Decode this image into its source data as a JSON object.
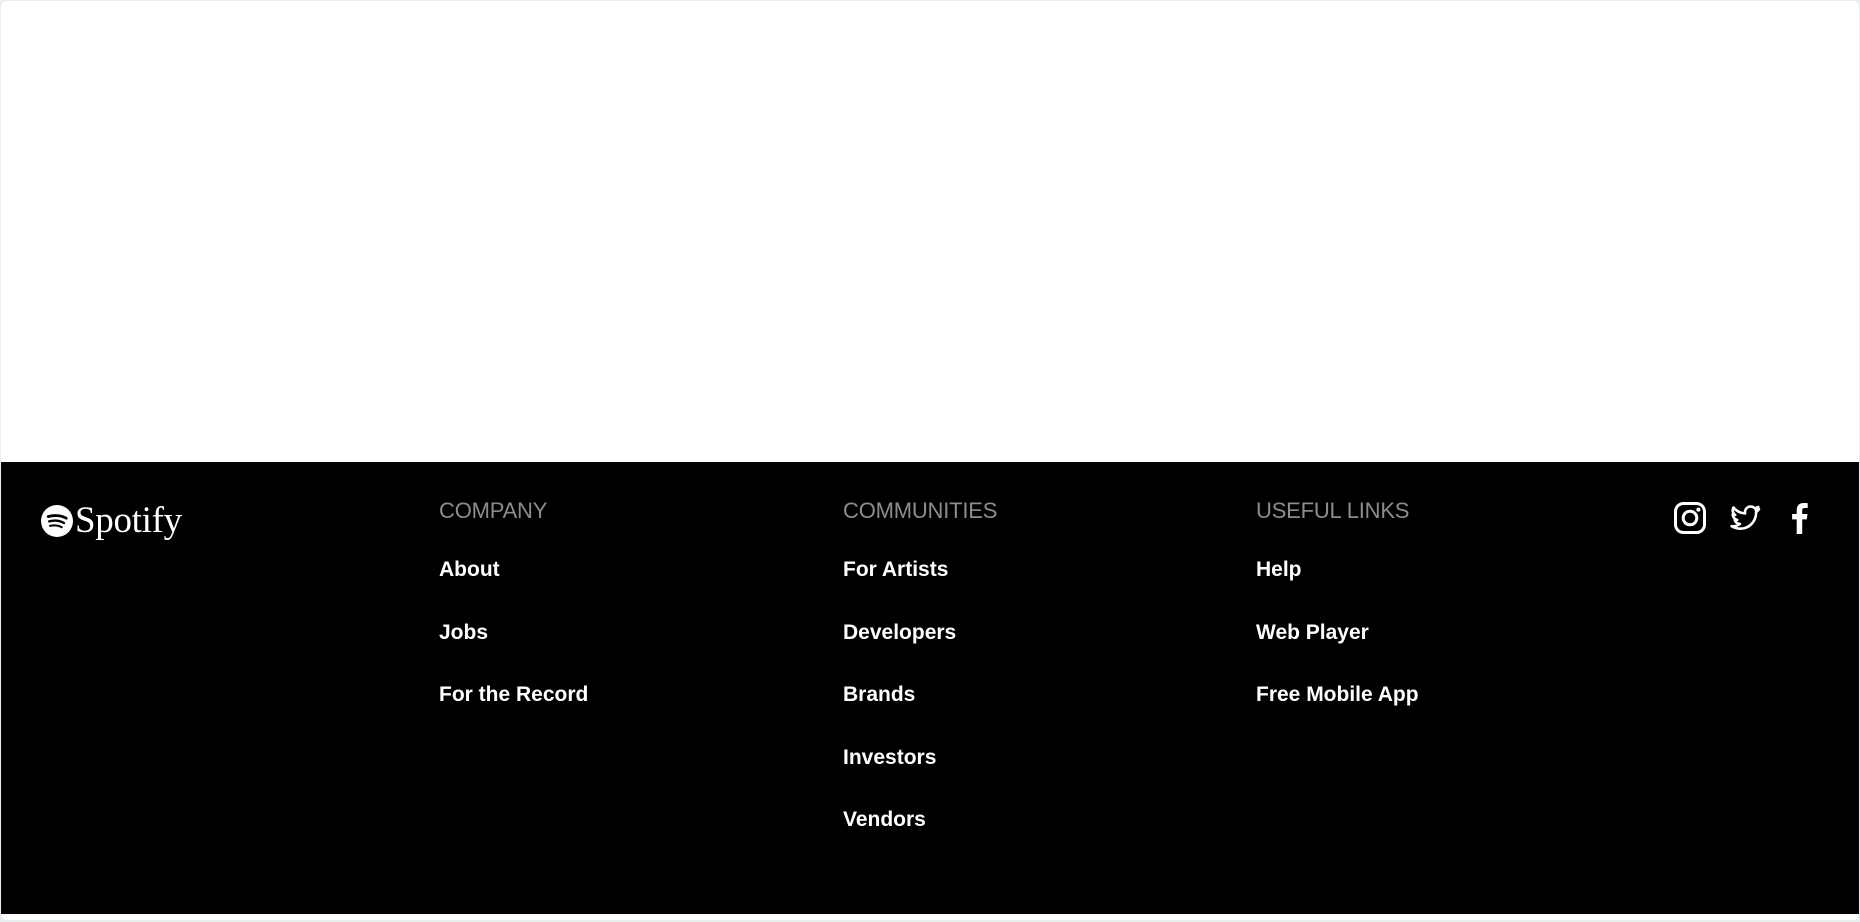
{
  "logo": {
    "text": "Spotify",
    "icon": "spotify-logo-icon"
  },
  "footer": {
    "columns": [
      {
        "heading": "COMPANY",
        "links": [
          "About",
          "Jobs",
          "For the Record"
        ]
      },
      {
        "heading": "COMMUNITIES",
        "links": [
          "For Artists",
          "Developers",
          "Brands",
          "Investors",
          "Vendors"
        ]
      },
      {
        "heading": "USEFUL LINKS",
        "links": [
          "Help",
          "Web Player",
          "Free Mobile App"
        ]
      }
    ],
    "social": [
      {
        "icon": "instagram-icon"
      },
      {
        "icon": "twitter-icon"
      },
      {
        "icon": "facebook-icon"
      }
    ]
  },
  "colors": {
    "footer_background": "#000000",
    "heading_gray": "#8c8c8c",
    "link_white": "#ffffff",
    "page_background": "#ffffff"
  }
}
